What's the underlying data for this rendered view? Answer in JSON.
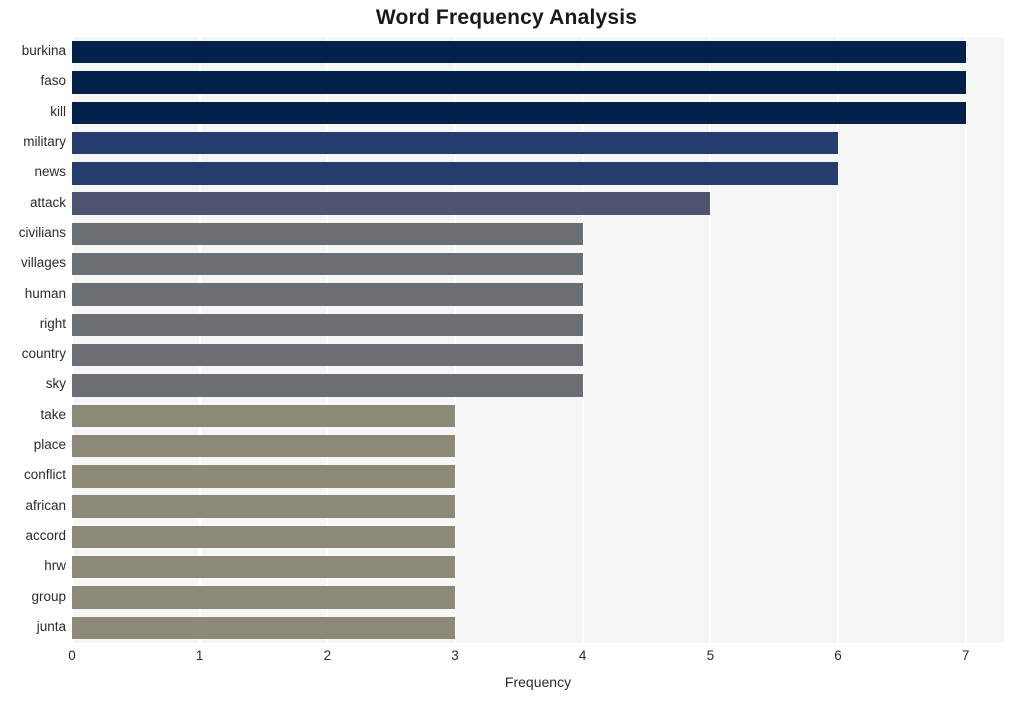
{
  "chart_data": {
    "type": "bar",
    "orientation": "horizontal",
    "title": "Word Frequency Analysis",
    "xlabel": "Frequency",
    "ylabel": "",
    "categories": [
      "burkina",
      "faso",
      "kill",
      "military",
      "news",
      "attack",
      "civilians",
      "villages",
      "human",
      "right",
      "country",
      "sky",
      "take",
      "place",
      "conflict",
      "african",
      "accord",
      "hrw",
      "group",
      "junta"
    ],
    "values": [
      7,
      7,
      7,
      6,
      6,
      5,
      4,
      4,
      4,
      4,
      4,
      4,
      3,
      3,
      3,
      3,
      3,
      3,
      3,
      3
    ],
    "bar_colors": [
      "#02214b",
      "#02214b",
      "#02214b",
      "#253c6e",
      "#253c6e",
      "#4e5470",
      "#6b6e73",
      "#6b6e73",
      "#6b6e73",
      "#6b6e73",
      "#6b6e73",
      "#6b6e73",
      "#8d8979",
      "#8d8979",
      "#8d8979",
      "#8d8979",
      "#8d8979",
      "#8d8979",
      "#8d8979",
      "#8d8979"
    ],
    "xlim": [
      0,
      7.3
    ],
    "x_ticks": [
      "0",
      "1",
      "2",
      "3",
      "4",
      "5",
      "6",
      "7"
    ],
    "x_tick_values": [
      0,
      1,
      2,
      3,
      4,
      5,
      6,
      7
    ],
    "grid": true,
    "grid_axis": "x",
    "legend": false,
    "plot_background": "#f6f6f7",
    "figure_background": "#ffffff",
    "gridline_color": "#ffffff"
  }
}
